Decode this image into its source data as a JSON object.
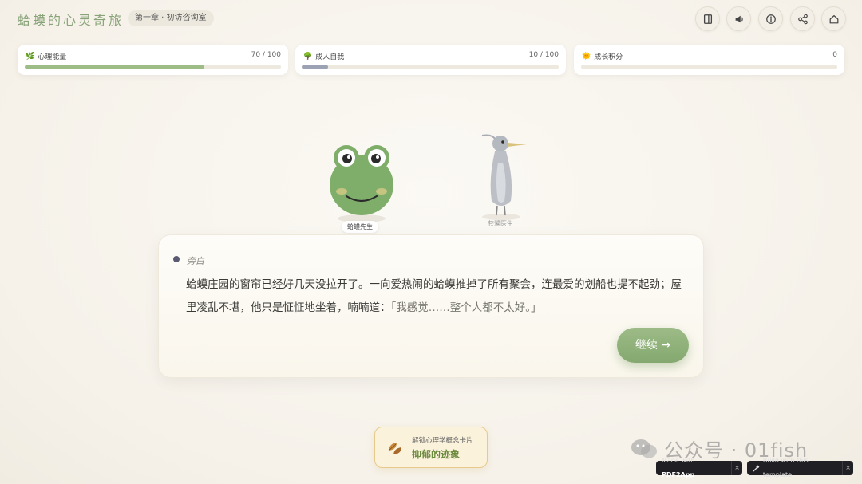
{
  "header": {
    "title": "蛤蟆的心灵奇旅",
    "chapter": "第一章 · 初访咨询室",
    "tools": [
      {
        "name": "book-icon"
      },
      {
        "name": "volume-icon"
      },
      {
        "name": "info-icon"
      },
      {
        "name": "share-icon"
      },
      {
        "name": "home-icon"
      }
    ]
  },
  "stats": [
    {
      "label": "心理能量",
      "icon": "sprout-icon",
      "value_text": "70 / 100",
      "fraction": 0.7,
      "color": "#9ebc86"
    },
    {
      "label": "成人自我",
      "icon": "tree-icon",
      "value_text": "10 / 100",
      "fraction": 0.1,
      "color": "#9aa2b4"
    },
    {
      "label": "成长积分",
      "icon": "sun-icon",
      "value_text": "0",
      "fraction": 0.0,
      "color": "#e3c46a"
    }
  ],
  "characters": {
    "frog_name": "蛤蟆先生",
    "heron_name": "苍鹭医生"
  },
  "dialog": {
    "speaker": "旁白",
    "text_main": "蛤蟆庄园的窗帘已经好几天没拉开了。一向爱热闹的蛤蟆推掉了所有聚会，连最爱的划船也提不起劲；屋里凌乱不堪，他只是怔怔地坐着，喃喃道：",
    "text_quote": "「我感觉……整个人都不太好。」",
    "continue_label": "继续 →"
  },
  "unlock": {
    "hint": "解锁心理学概念卡片",
    "concept": "抑郁的迹象"
  },
  "watermark": "公众号 · 01fish",
  "footer": {
    "made_with_prefix": "Made with",
    "made_with_brand": "PDF2App",
    "build_label": "Build with this template",
    "close_glyph": "×"
  }
}
